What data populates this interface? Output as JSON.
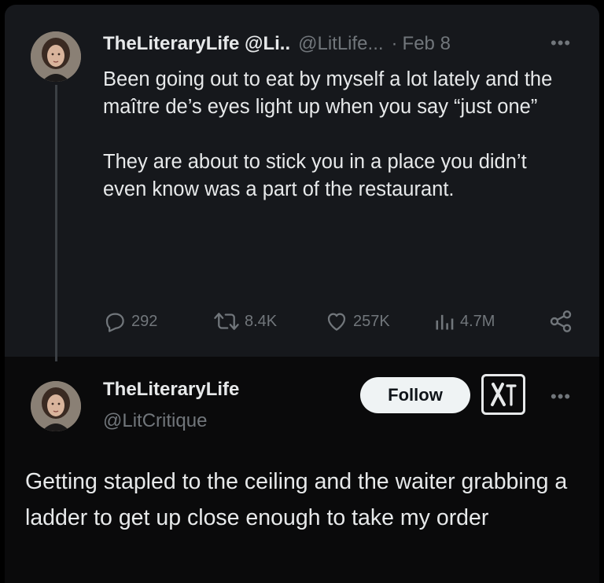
{
  "tweet": {
    "author_name": "TheLiteraryLife @Li..",
    "author_handle": "@LitLife...",
    "separator": "·",
    "date": "Feb 8",
    "more_label": "•••",
    "paragraphs": [
      "Been going out to eat by myself a lot lately and the maître de’s eyes light up when you say “just one”",
      "They are about to stick you in a place you didn’t even know was a part of the restaurant."
    ],
    "actions": {
      "replies": "292",
      "reposts": "8.4K",
      "likes": "257K",
      "views": "4.7M"
    },
    "icons": [
      "reply-icon",
      "repost-icon",
      "like-icon",
      "views-icon",
      "share-icon"
    ]
  },
  "reply": {
    "author_name": "TheLiteraryLife",
    "author_handle": "@LitCritique",
    "follow_label": "Follow",
    "more_label": "•••",
    "text": "Getting stapled to the ceiling and the waiter grabbing a ladder to get up close enough to take my order",
    "icons": [
      "x-logo-icon"
    ]
  },
  "colors": {
    "background": "#000000",
    "panel": "#16181c",
    "text": "#e7e9ea",
    "muted": "#71767b",
    "follow_button_bg": "#eff3f4"
  }
}
